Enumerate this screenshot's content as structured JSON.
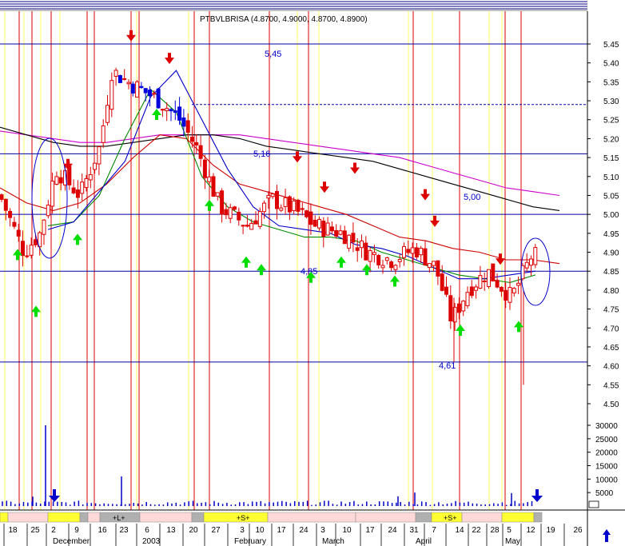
{
  "header": {
    "symbol_line": "PTBVLBRISA (4.8700, 4.9000, 4.8700, 4.8900)"
  },
  "chart_data": [
    {
      "type": "candlestick",
      "name": "price-panel",
      "title": "PTBVLBRISA (4.8700, 4.9000, 4.8700, 4.8900)",
      "ylim": [
        4.45,
        5.5
      ],
      "y_ticks": [
        4.5,
        4.55,
        4.6,
        4.65,
        4.7,
        4.75,
        4.8,
        4.85,
        4.9,
        4.95,
        5.0,
        5.05,
        5.1,
        5.15,
        5.2,
        5.25,
        5.3,
        5.35,
        5.4,
        5.45
      ],
      "y_tick_labels": [
        "4.50",
        "4.55",
        "4.60",
        "4.65",
        "4.70",
        "4.75",
        "4.80",
        "4.85",
        "4.90",
        "4.95",
        "5.00",
        "5.05",
        "5.10",
        "5.15",
        "5.20",
        "5.25",
        "5.30",
        "5.35",
        "5.40",
        "5.45"
      ],
      "x_day_labels": [
        "18",
        "25",
        "2",
        "9",
        "16",
        "23",
        "6",
        "13",
        "20",
        "27",
        "3",
        "10",
        "17",
        "24",
        "3",
        "10",
        "17",
        "24",
        "31",
        "7",
        "14",
        "22",
        "28",
        "5",
        "12",
        "19",
        "26"
      ],
      "x_month_labels": [
        "December",
        "2003",
        "February",
        "March",
        "April",
        "May"
      ],
      "horizontal_levels": [
        {
          "value": 5.45,
          "label": "5,45"
        },
        {
          "value": 5.16,
          "label": "5,16"
        },
        {
          "value": 5.0,
          "label": "5,00"
        },
        {
          "value": 4.85,
          "label": "4,85"
        },
        {
          "value": 4.61,
          "label": "4,61"
        }
      ],
      "dashed_level": 5.29,
      "series": [
        {
          "name": "",
          "color": "#cc00cc",
          "values": [
            5.22,
            5.21,
            5.2,
            5.19,
            5.19,
            5.2,
            5.21,
            5.21,
            5.21,
            5.21,
            5.2,
            5.19,
            5.18,
            5.17,
            5.16,
            5.15,
            5.13,
            5.11,
            5.09,
            5.07,
            5.06,
            5.05
          ]
        },
        {
          "name": "",
          "color": "#000000",
          "values": [
            5.23,
            5.21,
            5.19,
            5.18,
            5.18,
            5.19,
            5.2,
            5.21,
            5.21,
            5.2,
            5.18,
            5.17,
            5.16,
            5.15,
            5.14,
            5.12,
            5.1,
            5.08,
            5.06,
            5.04,
            5.02,
            5.01
          ]
        },
        {
          "name": "",
          "color": "#cc0000",
          "values": [
            5.07,
            5.03,
            5.01,
            5.03,
            5.08,
            5.15,
            5.21,
            5.2,
            5.13,
            5.08,
            5.06,
            5.04,
            5.02,
            5.0,
            4.97,
            4.94,
            4.93,
            4.91,
            4.9,
            4.88,
            4.88,
            4.87
          ]
        },
        {
          "name": "",
          "color": "#008800",
          "values": [
            4.97,
            4.98,
            5.05,
            5.2,
            5.33,
            5.27,
            5.1,
            5.02,
            4.98,
            4.96,
            4.94,
            4.94,
            4.93,
            4.9,
            4.88,
            4.86,
            4.84,
            4.83,
            4.82,
            4.84
          ]
        },
        {
          "name": "",
          "color": "#0000cc",
          "values": [
            4.96,
            4.98,
            5.06,
            5.14,
            5.31,
            5.38,
            5.25,
            5.12,
            5.02,
            4.97,
            4.96,
            4.95,
            4.92,
            4.91,
            4.89,
            4.86,
            4.83,
            4.83,
            4.84,
            4.85
          ]
        }
      ],
      "annotations": {
        "up_arrows": [
          4.93,
          4.78,
          4.97,
          5.3,
          5.06,
          4.91,
          4.89,
          4.87,
          4.91,
          4.89,
          4.86,
          4.73,
          4.74
        ],
        "down_arrows": [
          5.1,
          5.44,
          5.38,
          5.12,
          5.04,
          5.09,
          5.02,
          4.95,
          4.85
        ],
        "circles": 2
      }
    },
    {
      "type": "bar",
      "name": "volume-panel",
      "ylim": [
        0,
        35000
      ],
      "y_ticks": [
        5000,
        10000,
        15000,
        20000,
        25000,
        30000
      ],
      "y_tick_labels": [
        "5000",
        "10000",
        "15000",
        "20000",
        "25000",
        "30000"
      ],
      "peak_values": [
        30000,
        11000,
        3500,
        3600,
        5000,
        4800
      ],
      "signal_bar": [
        "",
        "+L+",
        "+S+",
        "+S+"
      ]
    }
  ]
}
